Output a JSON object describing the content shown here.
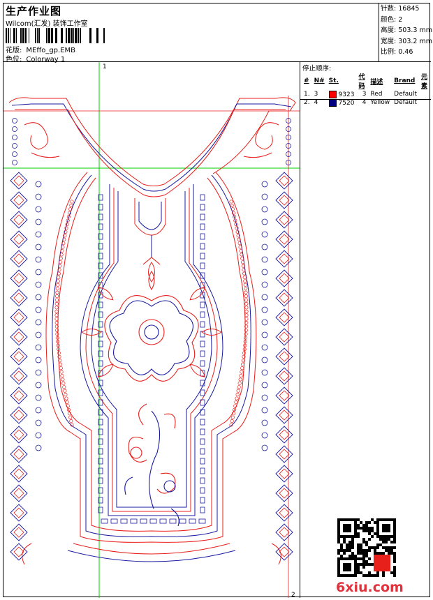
{
  "header": {
    "title": "生产作业图",
    "company": "Wilcom(汇发) 装饰工作室",
    "design_label": "花版:",
    "design_file": "MEffo_gp.EMB",
    "colorway_label": "色位:",
    "colorway": "Colorway 1"
  },
  "stats": [
    {
      "label": "针数:",
      "value": "16845"
    },
    {
      "label": "颜色:",
      "value": "2"
    },
    {
      "label": "高度:",
      "value": "503.3 mm"
    },
    {
      "label": "宽度:",
      "value": "303.2 mm"
    },
    {
      "label": "比例:",
      "value": "0.46"
    }
  ],
  "stop_sequence": {
    "caption": "停止顺序:",
    "columns": [
      "#",
      "N#",
      "St.",
      "代码",
      "描述",
      "Brand",
      "元素"
    ],
    "rows": [
      {
        "index": "1.",
        "needle": "3",
        "color_hex": "#ff0000",
        "code": "9323",
        "st": "3",
        "desc": "Red",
        "brand": "Default"
      },
      {
        "index": "2.",
        "needle": "4",
        "color_hex": "#000080",
        "code": "7520",
        "st": "4",
        "desc": "Yellow",
        "brand": "Default"
      }
    ]
  },
  "markers": {
    "first": "1",
    "second": "2"
  },
  "watermark": "6xiu.com",
  "colors": {
    "thread_red": "#e8201c",
    "thread_blue": "#1a1aa0",
    "guide_green": "#00cc00"
  }
}
